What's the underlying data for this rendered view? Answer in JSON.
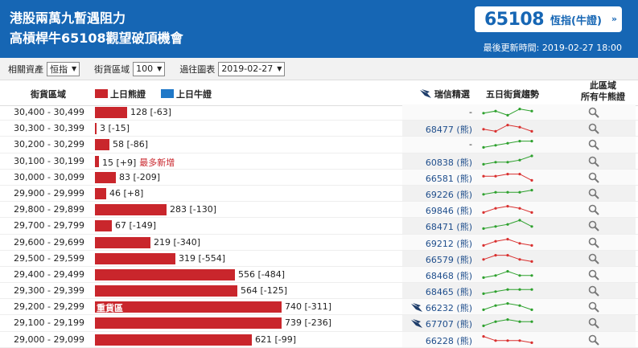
{
  "header": {
    "title_line1": "港股兩萬九暫遇阻力",
    "title_line2": "高槓桿牛65108觀望破頂機會",
    "price": "65108",
    "price_label": "恆指(牛證)",
    "price_arrow": "»",
    "updated": "最後更新時間: 2019-02-27 18:00"
  },
  "filters": {
    "asset_label": "相關資產",
    "asset_value": "恒指",
    "zone_label": "街貨區域",
    "zone_value": "100",
    "chart_label": "過往圖表",
    "chart_value": "2019-02-27"
  },
  "columns": {
    "range": "街貨區域",
    "legend_prev": "上日熊證",
    "legend_bull": "上日牛證",
    "pick": "瑞信精選",
    "trend": "五日街貨趨勢",
    "all_line1": "此區域",
    "all_line2": "所有牛熊證"
  },
  "colors": {
    "header_bg": "#1666b4",
    "bear_red": "#c9262c",
    "bull_blue": "#1f78c8",
    "trend_up": "#2ea12e",
    "trend_down": "#d9302f"
  },
  "rows": [
    {
      "range": "30,400 - 30,499",
      "qty": 128,
      "label": "128 [-63]",
      "code": "-",
      "bird": false,
      "trend": "green",
      "series": [
        3,
        4,
        2,
        5,
        4
      ]
    },
    {
      "range": "30,300 - 30,399",
      "qty": 3,
      "label": "3 [-15]",
      "code": "68477 (熊)",
      "bird": false,
      "trend": "red",
      "series": [
        3,
        2,
        5,
        4,
        2
      ]
    },
    {
      "range": "30,200 - 30,299",
      "qty": 58,
      "label": "58 [-86]",
      "code": "-",
      "bird": false,
      "trend": "green",
      "series": [
        2,
        3,
        4,
        5,
        5
      ]
    },
    {
      "range": "30,100 - 30,199",
      "qty": 15,
      "label": "15 [+9]",
      "extra": "最多新增",
      "code": "60838 (熊)",
      "bird": false,
      "trend": "green",
      "series": [
        2,
        3,
        3,
        4,
        6
      ]
    },
    {
      "range": "30,000 - 30,099",
      "qty": 83,
      "label": "83 [-209]",
      "code": "66581 (熊)",
      "bird": false,
      "trend": "red",
      "series": [
        4,
        4,
        5,
        5,
        2
      ]
    },
    {
      "range": "29,900 - 29,999",
      "qty": 46,
      "label": "46 [+8]",
      "code": "69226 (熊)",
      "bird": false,
      "trend": "green",
      "series": [
        3,
        4,
        4,
        4,
        5
      ]
    },
    {
      "range": "29,800 - 29,899",
      "qty": 283,
      "label": "283 [-130]",
      "code": "69846 (熊)",
      "bird": false,
      "trend": "red",
      "series": [
        2,
        4,
        5,
        4,
        2
      ]
    },
    {
      "range": "29,700 - 29,799",
      "qty": 67,
      "label": "67 [-149]",
      "code": "68471 (熊)",
      "bird": false,
      "trend": "green",
      "series": [
        2,
        3,
        4,
        6,
        3
      ]
    },
    {
      "range": "29,600 - 29,699",
      "qty": 219,
      "label": "219 [-340]",
      "code": "69212 (熊)",
      "bird": false,
      "trend": "red",
      "series": [
        2,
        4,
        5,
        3,
        2
      ]
    },
    {
      "range": "29,500 - 29,599",
      "qty": 319,
      "label": "319 [-554]",
      "code": "66579 (熊)",
      "bird": false,
      "trend": "red",
      "series": [
        3,
        5,
        5,
        3,
        2
      ]
    },
    {
      "range": "29,400 - 29,499",
      "qty": 556,
      "label": "556 [-484]",
      "code": "68468 (熊)",
      "bird": false,
      "trend": "green",
      "series": [
        2,
        3,
        5,
        3,
        3
      ]
    },
    {
      "range": "29,300 - 29,399",
      "qty": 564,
      "label": "564 [-125]",
      "code": "68465 (熊)",
      "bird": false,
      "trend": "green",
      "series": [
        2,
        3,
        4,
        4,
        4
      ]
    },
    {
      "range": "29,200 - 29,299",
      "qty": 740,
      "label": "740 [-311]",
      "badge": "重貨區",
      "code": "66232 (熊)",
      "bird": true,
      "trend": "green",
      "series": [
        2,
        4,
        5,
        4,
        2
      ]
    },
    {
      "range": "29,100 - 29,199",
      "qty": 739,
      "label": "739 [-236]",
      "code": "67707 (熊)",
      "bird": true,
      "trend": "green",
      "series": [
        2,
        4,
        5,
        4,
        4
      ]
    },
    {
      "range": "29,000 - 29,099",
      "qty": 621,
      "label": "621 [-99]",
      "code": "66228 (熊)",
      "bird": false,
      "trend": "red",
      "series": [
        5,
        3,
        3,
        3,
        2
      ]
    }
  ],
  "icons": {
    "pick": "credit-suisse-sail-icon",
    "search": "magnifier-icon",
    "select": "caret-down-icon"
  }
}
